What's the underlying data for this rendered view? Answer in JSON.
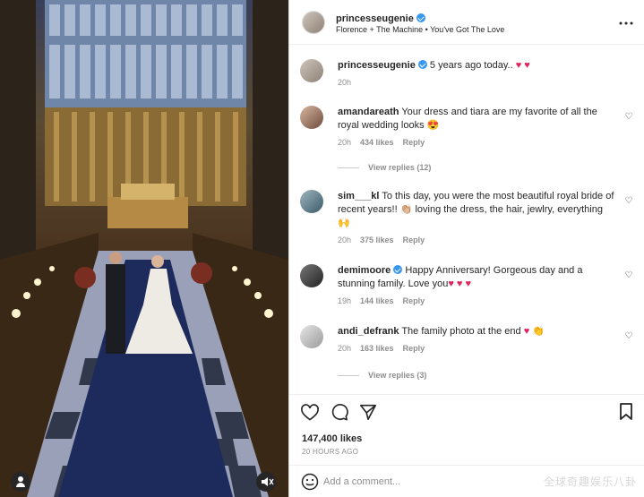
{
  "post": {
    "author": "princesseugenie",
    "audio": "Florence + The Machine • You've Got The Love",
    "caption_author": "princesseugenie",
    "caption": "5 years ago today..",
    "caption_emoji": "♥ ♥",
    "caption_time": "20h",
    "likes": "147,400 likes",
    "posted": "20 HOURS AGO",
    "more_icon": "more-horizontal-icon"
  },
  "comments": [
    {
      "user": "amandareath",
      "text": "Your dress and tiara are my favorite of all the royal wedding looks 😍",
      "time": "20h",
      "likes": "434 likes",
      "reply": "Reply",
      "view_replies": "View replies (12)"
    },
    {
      "user": "sim___kl",
      "text": "To this day, you were the most beautiful royal bride of recent years!! 👏🏼 loving the dress, the hair, jewlry, everything 🙌",
      "time": "20h",
      "likes": "375 likes",
      "reply": "Reply"
    },
    {
      "user": "demimoore",
      "text": "Happy Anniversary! Gorgeous day and a stunning family. Love you",
      "emoji": "♥ ♥ ♥",
      "time": "19h",
      "likes": "144 likes",
      "reply": "Reply"
    },
    {
      "user": "andi_defrank",
      "text": "The family photo at the end",
      "emoji": "♥ 👏",
      "time": "20h",
      "likes": "163 likes",
      "reply": "Reply",
      "view_replies": "View replies (3)"
    }
  ],
  "composer": {
    "placeholder": "Add a comment..."
  },
  "watermark": "全球奇趣娱乐八卦",
  "colors": {
    "heart": "#e0245e",
    "verified": "#3897f0",
    "muted": "#8e8e8e"
  }
}
